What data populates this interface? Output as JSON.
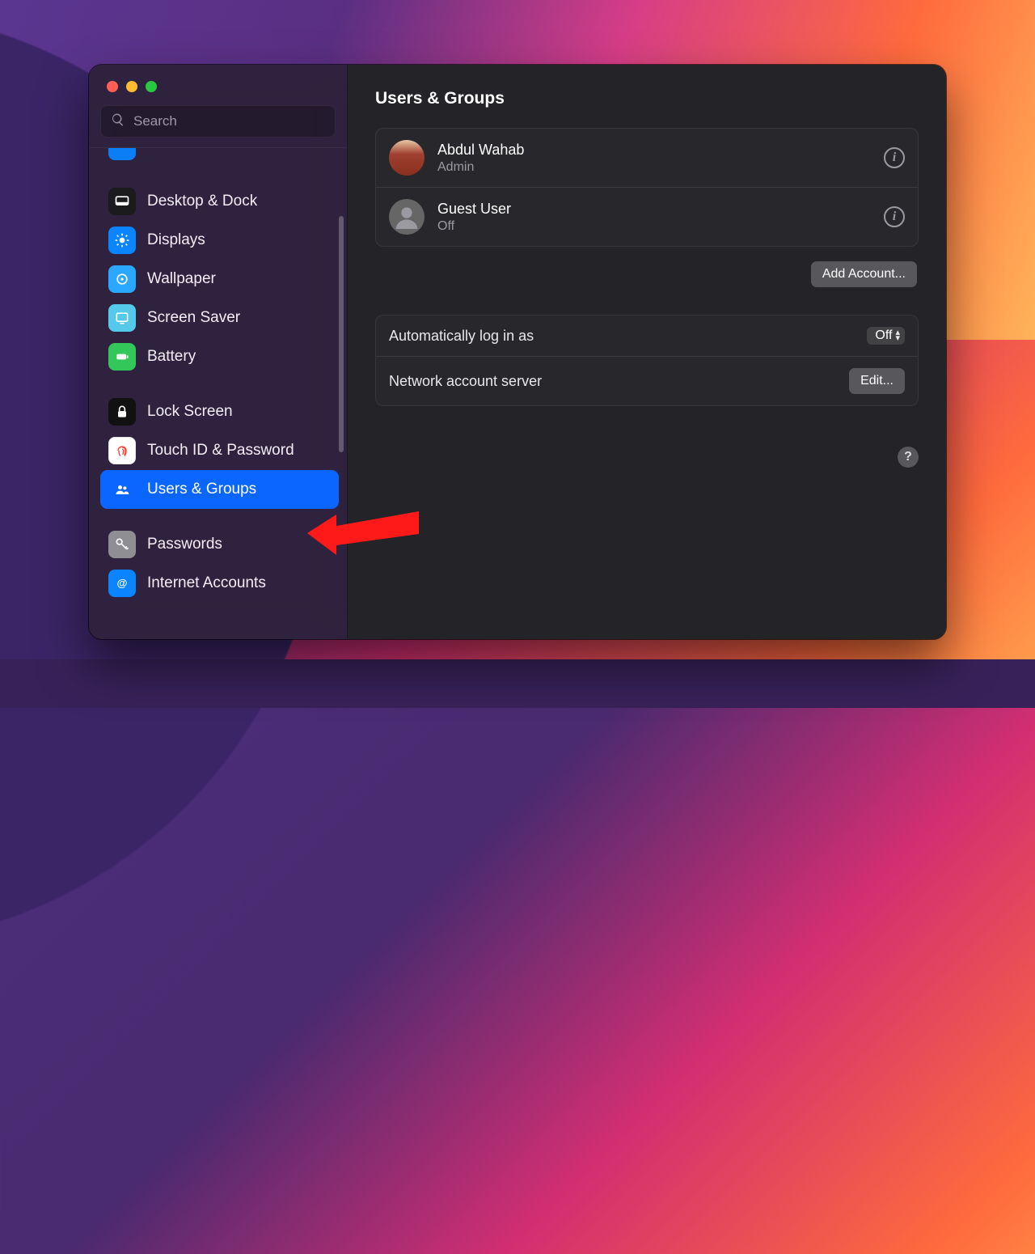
{
  "search": {
    "placeholder": "Search"
  },
  "sidebar": {
    "items": [
      {
        "label": ""
      },
      {
        "label": "Desktop & Dock"
      },
      {
        "label": "Displays"
      },
      {
        "label": "Wallpaper"
      },
      {
        "label": "Screen Saver"
      },
      {
        "label": "Battery"
      },
      {
        "label": "Lock Screen"
      },
      {
        "label": "Touch ID & Password"
      },
      {
        "label": "Users & Groups"
      },
      {
        "label": "Passwords"
      },
      {
        "label": "Internet Accounts"
      }
    ]
  },
  "header": {
    "title": "Users & Groups"
  },
  "users": [
    {
      "name": "Abdul Wahab",
      "role": "Admin"
    },
    {
      "name": "Guest User",
      "role": "Off"
    }
  ],
  "buttons": {
    "add_account": "Add Account...",
    "edit": "Edit...",
    "info": "i",
    "help": "?"
  },
  "settings": {
    "auto_login_label": "Automatically log in as",
    "auto_login_value": "Off",
    "network_label": "Network account server"
  }
}
